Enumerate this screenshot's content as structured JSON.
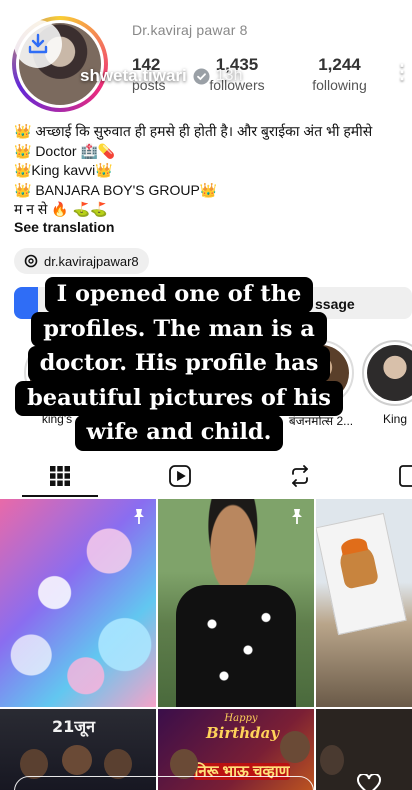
{
  "story": {
    "progress": [
      1.0,
      0.35
    ],
    "username": "shweta.tiwari",
    "time": "13h",
    "verified_icon": "verified-badge-icon",
    "download_icon": "download-icon"
  },
  "profile": {
    "name": "Dr.kaviraj pawar 8",
    "stats": [
      {
        "value": "142",
        "label": "posts"
      },
      {
        "value": "1,435",
        "label": "followers"
      },
      {
        "value": "1,244",
        "label": "following"
      }
    ],
    "bio": [
      "👑 अच्छाई कि सुरुवात ही हमसे ही होती है। और बुराईका अंत भी हमीसे",
      "👑 Doctor 🏥💊",
      "👑King kavvi👑",
      "👑 BANJARA BOY'S GROUP👑",
      "म न से 🔥 ⛳⛳"
    ],
    "see_translation": "See translation",
    "threads_handle": "dr.kavirajpawar8",
    "message_label": "ssage"
  },
  "highlights": [
    {
      "label": "king's"
    },
    {
      "label": "बंजनमोत्स 2..."
    },
    {
      "label": "King"
    }
  ],
  "tabs": [
    {
      "icon": "grid-icon",
      "active": true
    },
    {
      "icon": "reels-icon",
      "active": false
    },
    {
      "icon": "repost-icon",
      "active": false
    }
  ],
  "grid": {
    "cells": [
      {
        "kind": "bokeh",
        "pinned": true
      },
      {
        "kind": "man-in-shirt",
        "pinned": true
      },
      {
        "kind": "flag",
        "pinned": false
      },
      {
        "kind": "poster",
        "text": "21जून",
        "pinned": false
      },
      {
        "kind": "birthday",
        "text1": "Happy",
        "text2": "Birthday",
        "text3": "निरू भाऊ चव्हाण",
        "pinned": false
      },
      {
        "kind": "dark",
        "pinned": false
      }
    ]
  },
  "caption": {
    "lines": [
      "I opened one of the",
      "profiles. The man is a",
      "doctor. His profile has",
      "beautiful pictures of his",
      "wife and child."
    ]
  }
}
